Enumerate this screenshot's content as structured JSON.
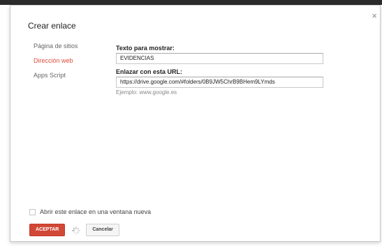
{
  "dialog": {
    "title": "Crear enlace",
    "close_glyph": "×"
  },
  "sidebar": {
    "items": [
      {
        "label": "Página de sitios",
        "active": false
      },
      {
        "label": "Dirección web",
        "active": true
      },
      {
        "label": "Apps Script",
        "active": false
      }
    ]
  },
  "form": {
    "display_text_label": "Texto para mostrar:",
    "display_text_value": "EVIDENCIAS",
    "url_label": "Enlazar con esta URL:",
    "url_value": "https://drive.google.com/#folders/0B9JW5ChrB9BHem9LYmds",
    "url_hint": "Ejemplo: www.google.es"
  },
  "options": {
    "new_window_label": "Abrir este enlace en una ventana nueva",
    "new_window_checked": false
  },
  "buttons": {
    "accept_label": "ACEPTAR",
    "cancel_label": "Cancelar"
  },
  "colors": {
    "accent": "#dd4b39",
    "primary_button": "#d14836"
  },
  "icons": {
    "close": "close-icon",
    "spinner": "loading-spinner-icon"
  }
}
